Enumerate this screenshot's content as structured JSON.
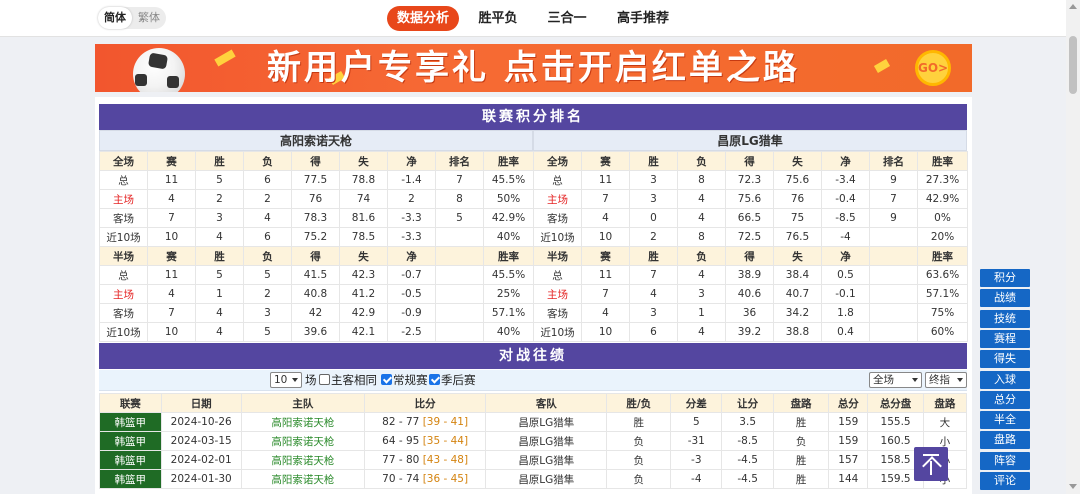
{
  "lang": {
    "simplified": "简体",
    "traditional": "繁体"
  },
  "nav": [
    {
      "label": "数据分析",
      "active": true
    },
    {
      "label": "胜平负",
      "active": false
    },
    {
      "label": "三合一",
      "active": false
    },
    {
      "label": "高手推荐",
      "active": false
    }
  ],
  "banner": {
    "text": "新用户专享礼 点击开启红单之路",
    "go": "GO>"
  },
  "standings": {
    "title": "联赛积分排名",
    "home_team": "高阳索诺天枪",
    "away_team": "昌原LG猎隼",
    "full_headers": [
      "全场",
      "赛",
      "胜",
      "负",
      "得",
      "失",
      "净",
      "排名",
      "胜率"
    ],
    "half_headers": [
      "半场",
      "赛",
      "胜",
      "负",
      "得",
      "失",
      "净",
      "",
      "胜率"
    ],
    "home_full": [
      [
        "总",
        "11",
        "5",
        "6",
        "77.5",
        "78.8",
        "-1.4",
        "7",
        "45.5%"
      ],
      [
        "主场",
        "4",
        "2",
        "2",
        "76",
        "74",
        "2",
        "8",
        "50%"
      ],
      [
        "客场",
        "7",
        "3",
        "4",
        "78.3",
        "81.6",
        "-3.3",
        "5",
        "42.9%"
      ],
      [
        "近10场",
        "10",
        "4",
        "6",
        "75.2",
        "78.5",
        "-3.3",
        "",
        "40%"
      ]
    ],
    "away_full": [
      [
        "总",
        "11",
        "3",
        "8",
        "72.3",
        "75.6",
        "-3.4",
        "9",
        "27.3%"
      ],
      [
        "主场",
        "7",
        "3",
        "4",
        "75.6",
        "76",
        "-0.4",
        "7",
        "42.9%"
      ],
      [
        "客场",
        "4",
        "0",
        "4",
        "66.5",
        "75",
        "-8.5",
        "9",
        "0%"
      ],
      [
        "近10场",
        "10",
        "2",
        "8",
        "72.5",
        "76.5",
        "-4",
        "",
        "20%"
      ]
    ],
    "home_half": [
      [
        "总",
        "11",
        "5",
        "5",
        "41.5",
        "42.3",
        "-0.7",
        "",
        "45.5%"
      ],
      [
        "主场",
        "4",
        "1",
        "2",
        "40.8",
        "41.2",
        "-0.5",
        "",
        "25%"
      ],
      [
        "客场",
        "7",
        "4",
        "3",
        "42",
        "42.9",
        "-0.9",
        "",
        "57.1%"
      ],
      [
        "近10场",
        "10",
        "4",
        "5",
        "39.6",
        "42.1",
        "-2.5",
        "",
        "40%"
      ]
    ],
    "away_half": [
      [
        "总",
        "11",
        "7",
        "4",
        "38.9",
        "38.4",
        "0.5",
        "",
        "63.6%"
      ],
      [
        "主场",
        "7",
        "4",
        "3",
        "40.6",
        "40.7",
        "-0.1",
        "",
        "57.1%"
      ],
      [
        "客场",
        "4",
        "3",
        "1",
        "36",
        "34.2",
        "1.8",
        "",
        "75%"
      ],
      [
        "近10场",
        "10",
        "6",
        "4",
        "39.2",
        "38.8",
        "0.4",
        "",
        "60%"
      ]
    ]
  },
  "h2h": {
    "title": "对战往绩",
    "filter": {
      "count": "10",
      "count_suffix": "场",
      "same_home_label": "主客相同",
      "regular_label": "常规赛",
      "playoff_label": "季后赛",
      "scope": "全场",
      "line": "终指"
    },
    "headers": [
      "联赛",
      "日期",
      "主队",
      "比分",
      "客队",
      "胜/负",
      "分差",
      "让分",
      "盘路",
      "总分",
      "总分盘",
      "盘路"
    ],
    "rows": [
      {
        "league": "韩篮甲",
        "date": "2024-10-26",
        "home": "高阳索诺天枪",
        "score": "82 - 77",
        "half": "[39 - 41]",
        "away": "昌原LG猎隼",
        "result": "胜",
        "diff": "5",
        "handicap": "3.5",
        "cover": "胜",
        "total": "159",
        "total_line": "155.5",
        "ou": "大"
      },
      {
        "league": "韩篮甲",
        "date": "2024-03-15",
        "home": "高阳索诺天枪",
        "score": "64 - 95",
        "half": "[35 - 44]",
        "away": "昌原LG猎隼",
        "result": "负",
        "diff": "-31",
        "handicap": "-8.5",
        "cover": "负",
        "total": "159",
        "total_line": "160.5",
        "ou": "小"
      },
      {
        "league": "韩篮甲",
        "date": "2024-02-01",
        "home": "高阳索诺天枪",
        "score": "77 - 80",
        "half": "[43 - 48]",
        "away": "昌原LG猎隼",
        "result": "负",
        "diff": "-3",
        "handicap": "-4.5",
        "cover": "胜",
        "total": "157",
        "total_line": "158.5",
        "ou": "小"
      },
      {
        "league": "韩篮甲",
        "date": "2024-01-30",
        "home": "高阳索诺天枪",
        "score": "70 - 74",
        "half": "[36 - 45]",
        "away": "昌原LG猎隼",
        "result": "负",
        "diff": "-4",
        "handicap": "-4.5",
        "cover": "胜",
        "total": "144",
        "total_line": "159.5",
        "ou": "小"
      }
    ]
  },
  "side_nav": [
    "积分",
    "战绩",
    "技统",
    "赛程",
    "得失",
    "入球",
    "总分",
    "半全",
    "盘路",
    "阵容",
    "评论"
  ]
}
